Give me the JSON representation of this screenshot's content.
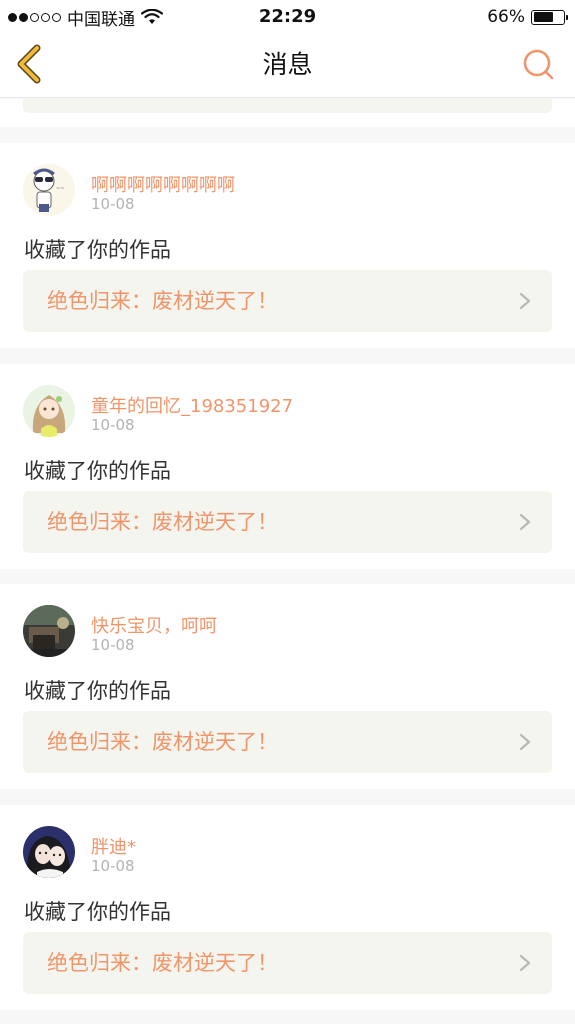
{
  "status_bar": {
    "signal_filled": 2,
    "signal_total": 5,
    "carrier": "中国联通",
    "time": "22:29",
    "battery_text": "66%",
    "battery_level": 0.66
  },
  "nav": {
    "title": "消息",
    "back_icon": "chevron-left-icon",
    "search_icon": "search-icon"
  },
  "colors": {
    "accent": "#f0956a",
    "back_arrow": "#f0b83c",
    "box_bg": "#f5f5ef"
  },
  "messages": [
    {
      "username": "啊啊啊啊啊啊啊啊",
      "date": "10-08",
      "action": "收藏了你的作品",
      "work_title": "绝色归来：废材逆天了！"
    },
    {
      "username": "童年的回忆_198351927",
      "date": "10-08",
      "action": "收藏了你的作品",
      "work_title": "绝色归来：废材逆天了！"
    },
    {
      "username": "快乐宝贝，呵呵",
      "date": "10-08",
      "action": "收藏了你的作品",
      "work_title": "绝色归来：废材逆天了！"
    },
    {
      "username": "胖迪*",
      "date": "10-08",
      "action": "收藏了你的作品",
      "work_title": "绝色归来：废材逆天了！"
    }
  ]
}
